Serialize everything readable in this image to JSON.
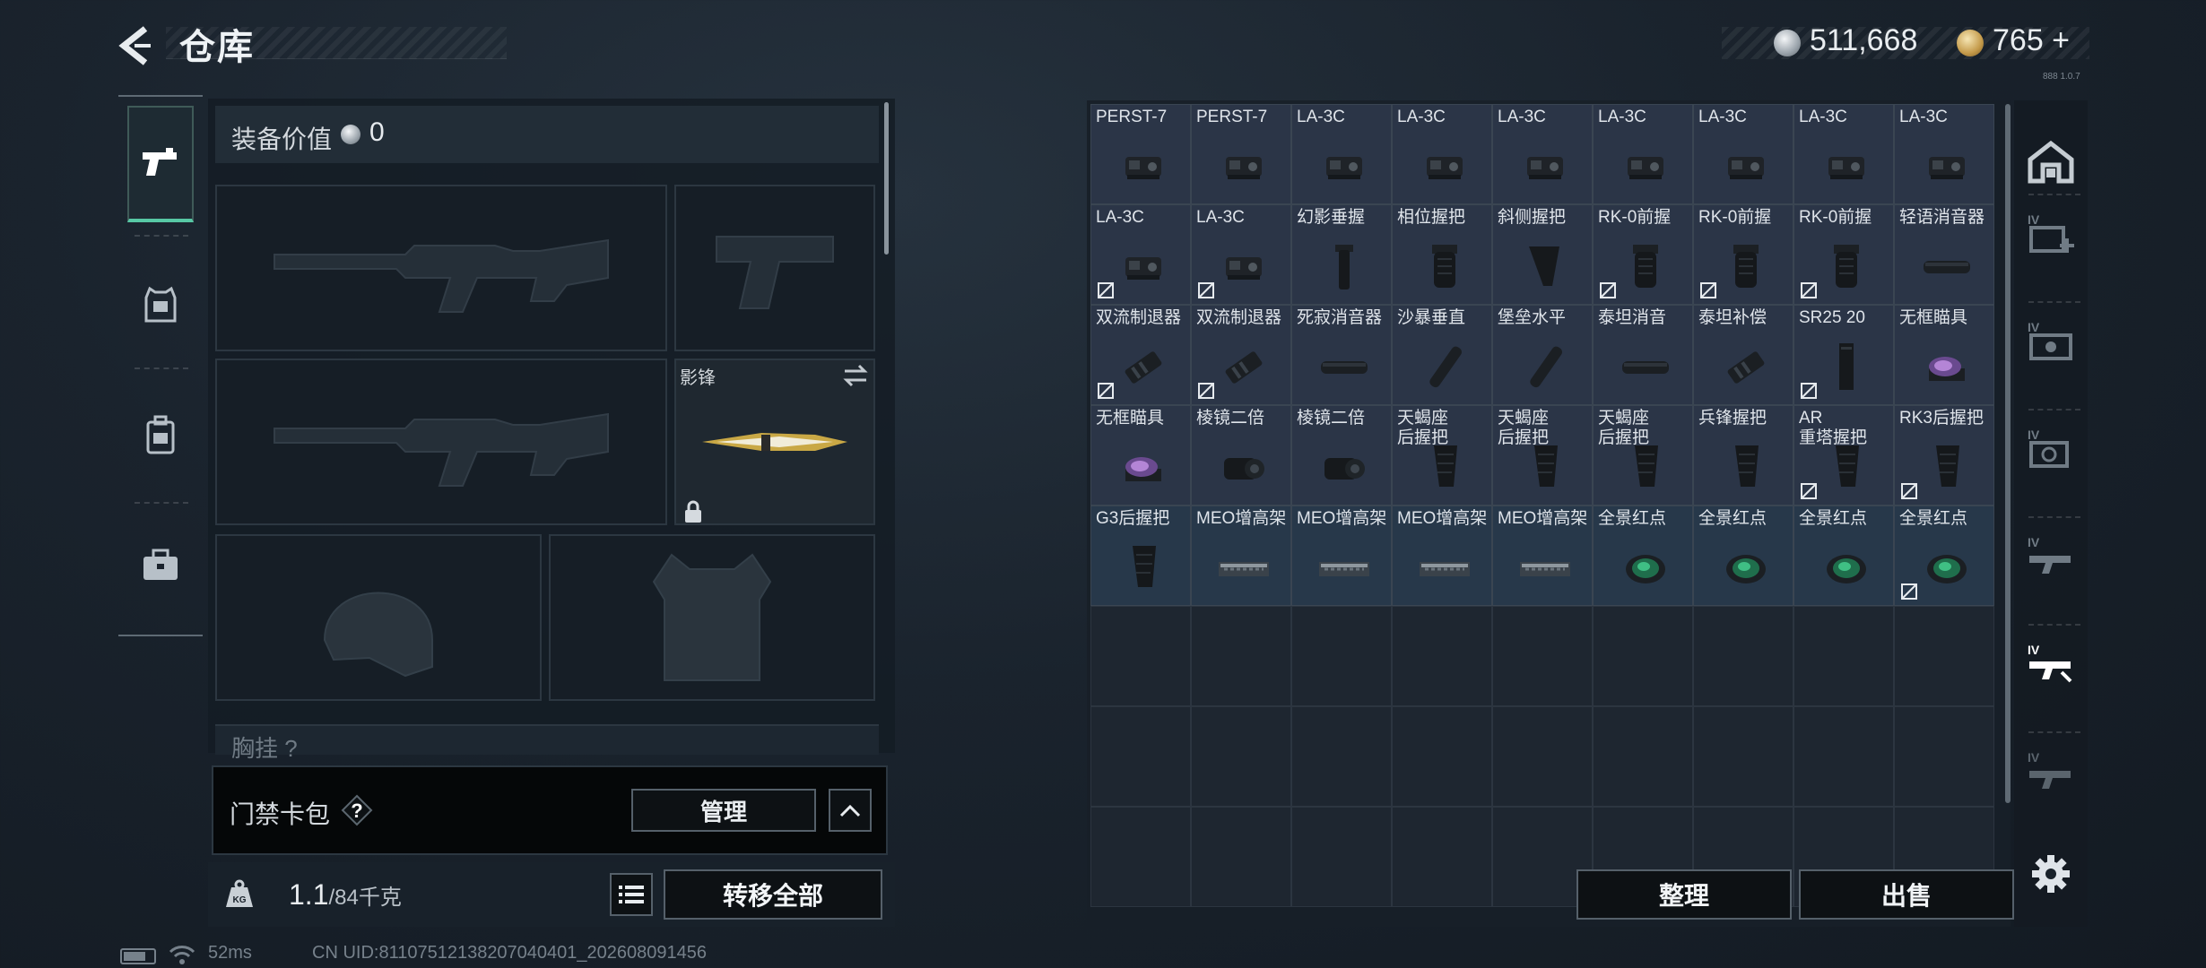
{
  "header": {
    "title": "仓库"
  },
  "currency": {
    "silver": "511,668",
    "gold": "765 +"
  },
  "version_text": "888 1.0.7",
  "equipment": {
    "value_label": "装备价值",
    "value": "0",
    "melee_name": "影锋",
    "chest_label": "胸挂",
    "chest_badge": "?"
  },
  "keycard": {
    "label": "门禁卡包",
    "help": "?",
    "manage_label": "管理"
  },
  "capacity": {
    "current": "1.1",
    "max": "/84千克"
  },
  "transfer_label": "转移全部",
  "actions": {
    "sort_label": "整理",
    "sell_label": "出售"
  },
  "footer": {
    "ping": "52ms",
    "uid": "CN UID:81107512138207040401_202608091456"
  },
  "colors": {
    "accent": "#57c8a5",
    "cell": "#2b3547",
    "panel": "#18212a"
  },
  "storage": {
    "items": [
      {
        "name": "PERST-7",
        "icon": "tactical-device",
        "flag": false
      },
      {
        "name": "PERST-7",
        "icon": "tactical-device",
        "flag": false
      },
      {
        "name": "LA-3C",
        "icon": "tactical-device",
        "flag": false
      },
      {
        "name": "LA-3C",
        "icon": "tactical-device",
        "flag": false
      },
      {
        "name": "LA-3C",
        "icon": "tactical-device",
        "flag": false
      },
      {
        "name": "LA-3C",
        "icon": "tactical-device",
        "flag": false
      },
      {
        "name": "LA-3C",
        "icon": "tactical-device",
        "flag": false
      },
      {
        "name": "LA-3C",
        "icon": "tactical-device",
        "flag": false
      },
      {
        "name": "LA-3C",
        "icon": "tactical-device",
        "flag": false
      },
      {
        "name": "LA-3C",
        "icon": "tactical-device",
        "flag": true
      },
      {
        "name": "LA-3C",
        "icon": "tactical-device",
        "flag": true
      },
      {
        "name": "幻影垂握",
        "icon": "vertical-grip",
        "flag": false
      },
      {
        "name": "相位握把",
        "icon": "grip",
        "flag": false
      },
      {
        "name": "斜侧握把",
        "icon": "angled-grip",
        "flag": false
      },
      {
        "name": "RK-0前握",
        "icon": "grip",
        "flag": true
      },
      {
        "name": "RK-0前握",
        "icon": "grip",
        "flag": true
      },
      {
        "name": "RK-0前握",
        "icon": "grip",
        "flag": true
      },
      {
        "name": "轻语消音器",
        "icon": "suppressor",
        "flag": false
      },
      {
        "name": "双流制退器",
        "icon": "muzzle-brake",
        "flag": true
      },
      {
        "name": "双流制退器",
        "icon": "muzzle-brake",
        "flag": true
      },
      {
        "name": "死寂消音器",
        "icon": "suppressor",
        "flag": false
      },
      {
        "name": "沙暴垂直",
        "icon": "suppressor-long",
        "flag": false
      },
      {
        "name": "堡垒水平",
        "icon": "suppressor-long",
        "flag": false
      },
      {
        "name": "泰坦消音",
        "icon": "suppressor",
        "flag": false
      },
      {
        "name": "泰坦补偿",
        "icon": "muzzle-brake",
        "flag": false
      },
      {
        "name": "SR25 20",
        "icon": "magazine",
        "flag": true
      },
      {
        "name": "无框瞄具",
        "icon": "reflex-sight",
        "flag": false
      },
      {
        "name": "无框瞄具",
        "icon": "reflex-sight",
        "flag": false
      },
      {
        "name": "棱镜二倍",
        "icon": "prism-scope",
        "flag": false
      },
      {
        "name": "棱镜二倍",
        "icon": "prism-scope",
        "flag": false
      },
      {
        "name": "天蝎座\n后握把",
        "icon": "pistol-grip",
        "flag": false
      },
      {
        "name": "天蝎座\n后握把",
        "icon": "pistol-grip",
        "flag": false
      },
      {
        "name": "天蝎座\n后握把",
        "icon": "pistol-grip",
        "flag": false
      },
      {
        "name": "兵锋握把",
        "icon": "pistol-grip",
        "flag": false
      },
      {
        "name": "AR\n重塔握把",
        "icon": "pistol-grip",
        "flag": true
      },
      {
        "name": "RK3后握把",
        "icon": "pistol-grip",
        "flag": true
      },
      {
        "name": "G3后握把",
        "icon": "pistol-grip",
        "flag": false
      },
      {
        "name": "MEO增高架",
        "icon": "riser-mount",
        "flag": false
      },
      {
        "name": "MEO增高架",
        "icon": "riser-mount",
        "flag": false
      },
      {
        "name": "MEO增高架",
        "icon": "riser-mount",
        "flag": false
      },
      {
        "name": "MEO增高架",
        "icon": "riser-mount",
        "flag": false
      },
      {
        "name": "全景红点",
        "icon": "red-dot",
        "flag": false
      },
      {
        "name": "全景红点",
        "icon": "red-dot",
        "flag": false
      },
      {
        "name": "全景红点",
        "icon": "red-dot",
        "flag": false
      },
      {
        "name": "全景红点",
        "icon": "red-dot",
        "flag": true
      }
    ]
  }
}
